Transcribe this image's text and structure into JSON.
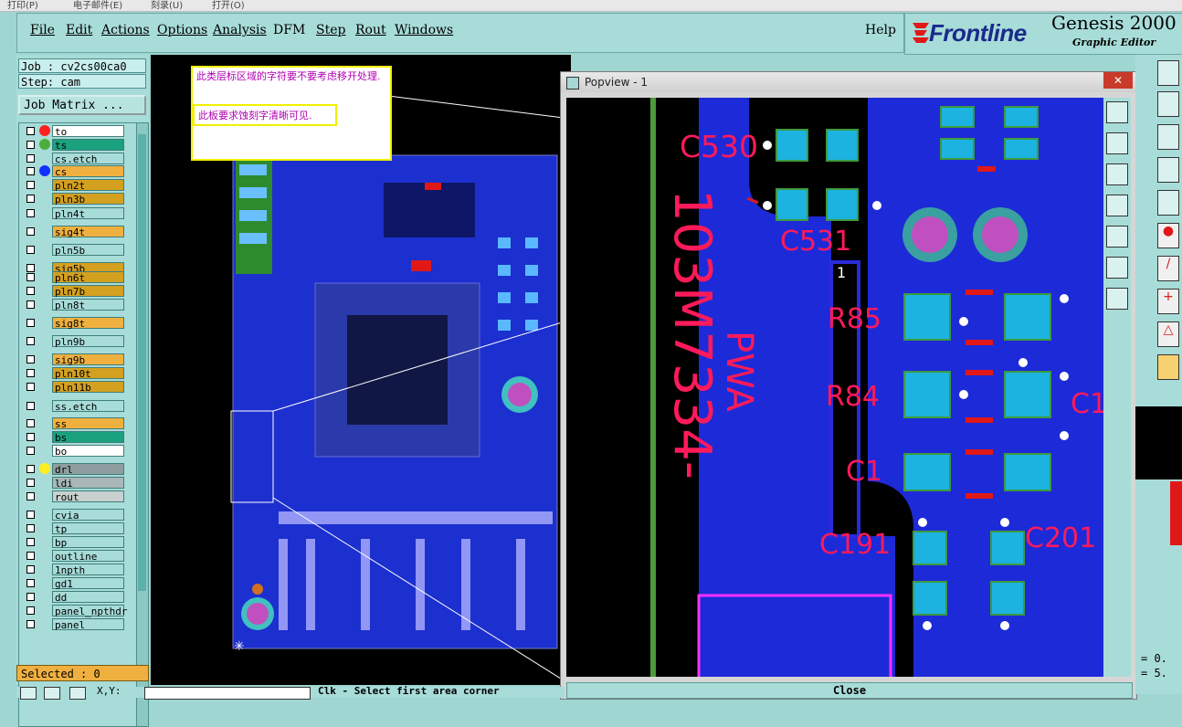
{
  "top_strip": [
    "打印(P)",
    "电子邮件(E)",
    "刻录(U)",
    "打开(O)"
  ],
  "menu": [
    "File",
    "Edit",
    "Actions",
    "Options",
    "Analysis",
    "DFM",
    "Step",
    "Rout",
    "Windows"
  ],
  "help_label": "Help",
  "brand": {
    "logo": "Frontline",
    "title": "Genesis 2000",
    "subtitle": "Graphic Editor"
  },
  "job": {
    "job_label": "Job : cv2cs00ca0",
    "step_label": "Step: cam",
    "matrix_label": "Job Matrix ..."
  },
  "layers": [
    {
      "name": "to",
      "color": "#ffffff",
      "dot": "#ff2020",
      "active": true
    },
    {
      "name": "ts",
      "color": "#1aa17e",
      "dot": "#4caf3c"
    },
    {
      "name": "cs.etch",
      "color": "#a8dcd8"
    },
    {
      "name": "cs",
      "color": "#f0b040",
      "dot": "#1030ff"
    },
    {
      "name": "pln2t",
      "color": "#d4a020"
    },
    {
      "name": "pln3b",
      "color": "#d4a020"
    },
    {
      "name": "pln4t",
      "color": "#a8dcd8"
    },
    {
      "name": "sig4t",
      "color": "#f0b040"
    },
    {
      "name": "pln5b",
      "color": "#a8dcd8"
    },
    {
      "name": "sig5b",
      "color": "#d4a020"
    },
    {
      "name": "pln6t",
      "color": "#d4a020"
    },
    {
      "name": "pln7b",
      "color": "#d4a020"
    },
    {
      "name": "pln8t",
      "color": "#a8dcd8"
    },
    {
      "name": "sig8t",
      "color": "#f0b040"
    },
    {
      "name": "pln9b",
      "color": "#a8dcd8"
    },
    {
      "name": "sig9b",
      "color": "#f0b040"
    },
    {
      "name": "pln10t",
      "color": "#d4a020"
    },
    {
      "name": "pln11b",
      "color": "#d4a020"
    },
    {
      "name": "ss.etch",
      "color": "#a8dcd8"
    },
    {
      "name": "ss",
      "color": "#f0b040"
    },
    {
      "name": "bs",
      "color": "#1aa17e"
    },
    {
      "name": "bo",
      "color": "#ffffff"
    },
    {
      "name": "drl",
      "color": "#8e9ea0",
      "dot": "#ffee20"
    },
    {
      "name": "ldi",
      "color": "#a9b7b8"
    },
    {
      "name": "rout",
      "color": "#c8d0d0"
    },
    {
      "name": "cvia",
      "color": "#a8dcd8"
    },
    {
      "name": "tp",
      "color": "#a8dcd8"
    },
    {
      "name": "bp",
      "color": "#a8dcd8"
    },
    {
      "name": "outline",
      "color": "#a8dcd8"
    },
    {
      "name": "1npth",
      "color": "#a8dcd8"
    },
    {
      "name": "gd1",
      "color": "#a8dcd8"
    },
    {
      "name": "dd",
      "color": "#a8dcd8"
    },
    {
      "name": "panel_npthdr",
      "color": "#a8dcd8"
    },
    {
      "name": "panel",
      "color": "#a8dcd8"
    }
  ],
  "selected_label": "Selected : 0",
  "note": {
    "line1": "此类层标区域的字符要不要考虑移开处理.",
    "line2": "此板要求蚀刻字清晰可见."
  },
  "popup": {
    "title": "Popview - 1",
    "close_label": "Close",
    "close_x": "✕"
  },
  "popup_labels": {
    "c530": "C530",
    "c531": "C531",
    "r85": "R85",
    "r84": "R84",
    "c1": "C1",
    "c191": "C191",
    "c201": "C201",
    "c1b": "C1",
    "pin1": "1",
    "pwa": "PWA",
    "part": "103M7334-"
  },
  "bottom": {
    "xy": "X,Y:",
    "prompt": "Clk - Select first area corner"
  },
  "right_readout": [
    "= 0.",
    "= 5."
  ],
  "icons": [
    "lock-icon",
    "zoom-in-icon",
    "zoom-out-icon",
    "pan-left-icon",
    "pan-right-icon",
    "fit-icon",
    "home-icon"
  ]
}
